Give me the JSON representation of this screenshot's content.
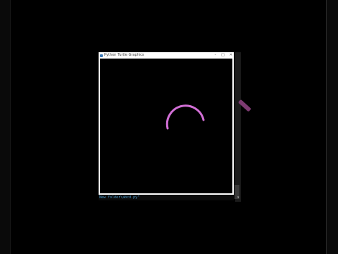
{
  "window": {
    "title": "Python Turtle Graphics",
    "controls": {
      "minimize": "–",
      "maximize": "□",
      "close": "✕"
    }
  },
  "canvas": {
    "arc_color": "#d26fd6",
    "background": "#000000"
  },
  "terminal": {
    "command_text": "New folder\\abcd.py\""
  },
  "colors": {
    "title_icon": "#3d7ab8",
    "terminal_text": "#4a9acb",
    "background_stroke": "#7d3b72"
  },
  "icons": {
    "title": "python-icon",
    "scroll": "chevron-down-icon"
  }
}
